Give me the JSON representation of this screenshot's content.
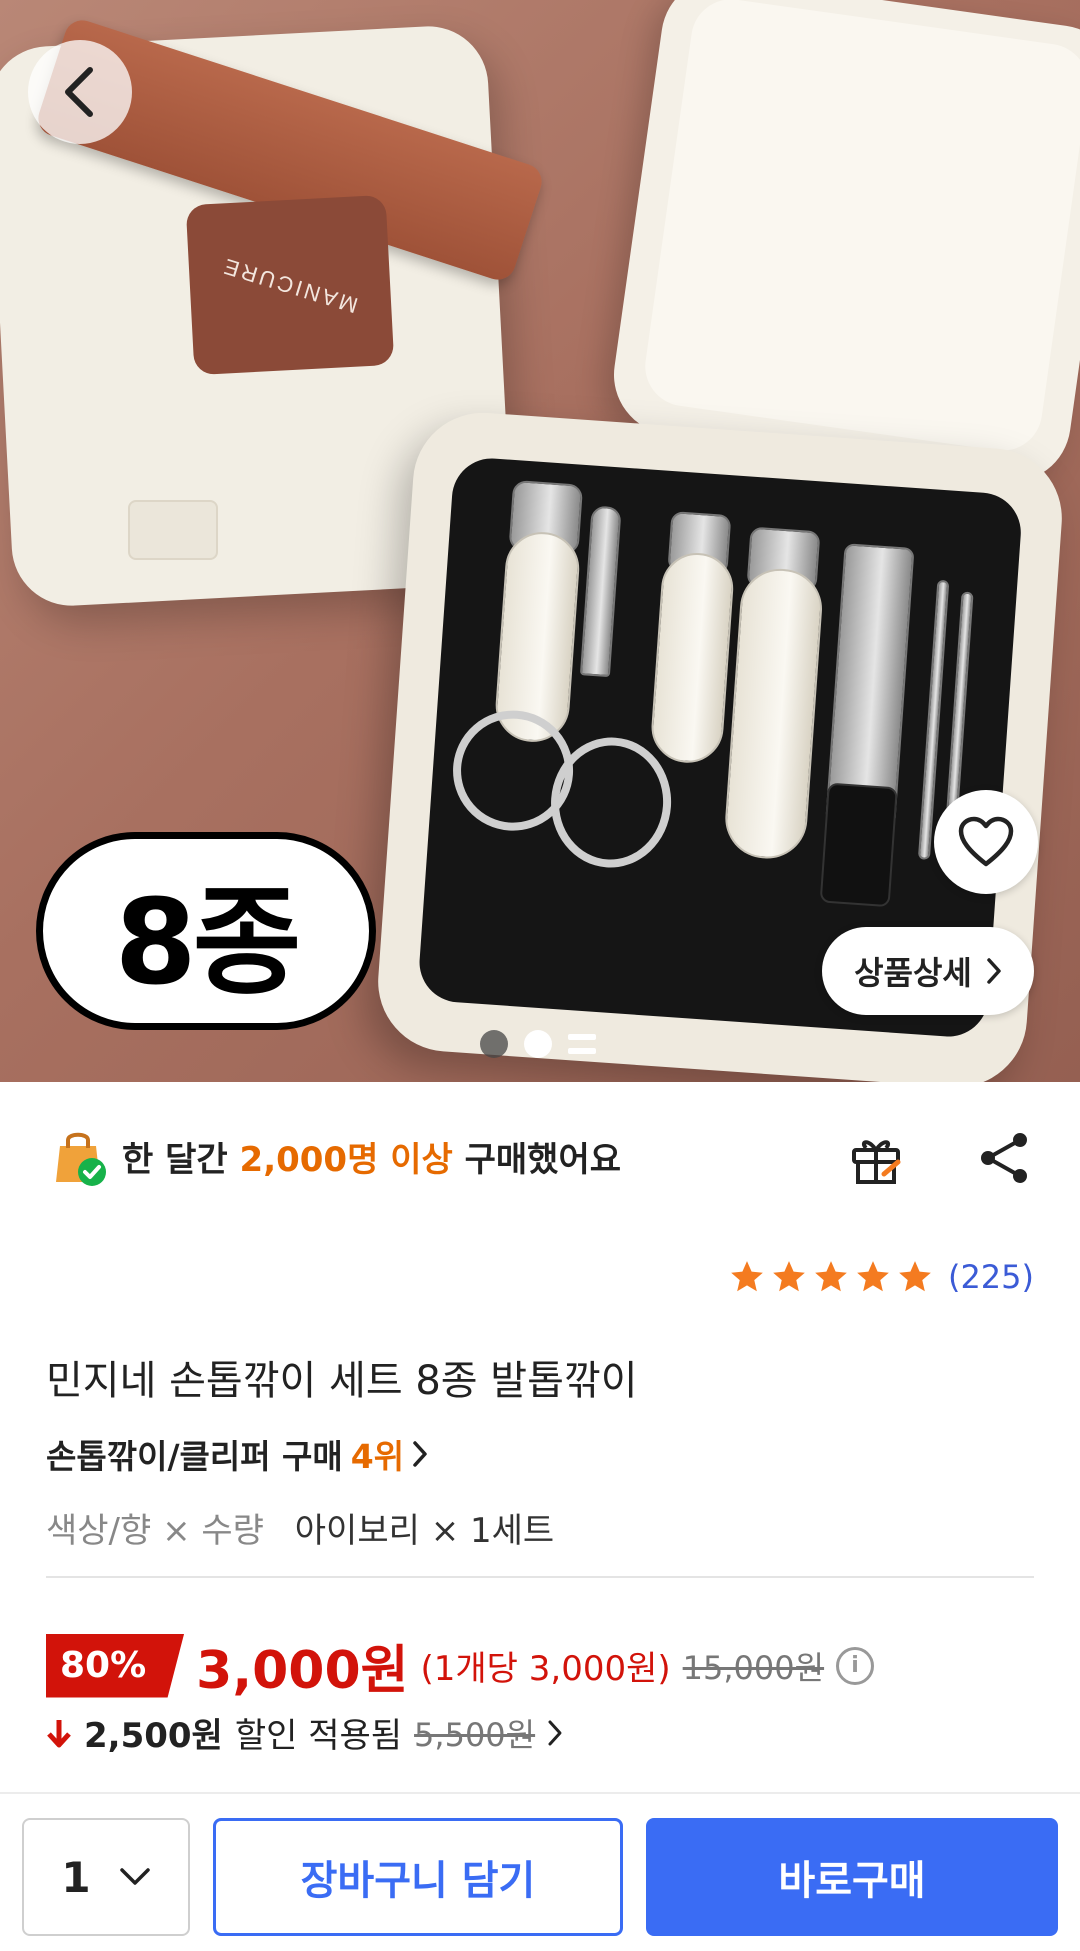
{
  "hero": {
    "brand_text": "MANICURE",
    "badge_text": "8종",
    "detail_button_label": "상품상세",
    "carousel": {
      "total_dots": 2,
      "active_index": 1
    }
  },
  "social_proof": {
    "prefix": "한 달간",
    "highlight": "2,000명 이상",
    "suffix": "구매했어요"
  },
  "rating": {
    "stars": 5,
    "count_text": "(225)"
  },
  "product": {
    "title": "민지네 손톱깎이 세트 8종 발톱깎이",
    "rank_category": "손톱깎이/클리퍼 구매",
    "rank_number": "4위",
    "option_label": "색상/향 × 수량",
    "option_value": "아이보리 × 1세트"
  },
  "price": {
    "discount": "80%",
    "sale_price": "3,000원",
    "unit_price": "(1개당 3,000원)",
    "original_price": "15,000원"
  },
  "coupon": {
    "amount": "2,500원",
    "text": "할인 적용됨",
    "original": "5,500원"
  },
  "bottom_bar": {
    "quantity": "1",
    "cart_label": "장바구니 담기",
    "buy_label": "바로구매"
  },
  "colors": {
    "accent_blue": "#3a6cf4",
    "sale_red": "#d2130a",
    "highlight_orange": "#e66a00",
    "star_orange": "#f47b20",
    "rating_blue": "#3b5bd6"
  },
  "icons": {
    "back": "chevron-left-icon",
    "wishlist": "heart-icon",
    "detail": "chevron-right-icon",
    "bag": "shopping-bag-check-icon",
    "gift": "gift-icon",
    "share": "share-icon",
    "info": "info-icon",
    "down_arrow": "arrow-down-icon",
    "qty_dropdown": "chevron-down-icon"
  }
}
